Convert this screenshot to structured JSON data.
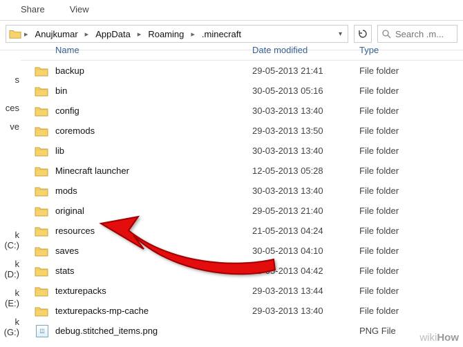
{
  "ribbon": {
    "share": "Share",
    "view": "View"
  },
  "breadcrumb": [
    "Anujkumar",
    "AppData",
    "Roaming",
    ".minecraft"
  ],
  "search": {
    "placeholder": "Search .m..."
  },
  "columns": {
    "name": "Name",
    "date": "Date modified",
    "type": "Type"
  },
  "nav_fragments": {
    "s": "s",
    "ces": "ces",
    "ve": "ve",
    "drives": [
      "k (C:)",
      "k (D:)",
      "k (E:)",
      "k (G:)"
    ]
  },
  "rows": [
    {
      "icon": "folder",
      "name": "backup",
      "date": "29-05-2013 21:41",
      "type": "File folder"
    },
    {
      "icon": "folder",
      "name": "bin",
      "date": "30-05-2013 05:16",
      "type": "File folder"
    },
    {
      "icon": "folder",
      "name": "config",
      "date": "30-03-2013 13:40",
      "type": "File folder"
    },
    {
      "icon": "folder",
      "name": "coremods",
      "date": "29-03-2013 13:50",
      "type": "File folder"
    },
    {
      "icon": "folder",
      "name": "lib",
      "date": "30-03-2013 13:40",
      "type": "File folder"
    },
    {
      "icon": "folder",
      "name": "Minecraft launcher",
      "date": "12-05-2013 05:28",
      "type": "File folder"
    },
    {
      "icon": "folder",
      "name": "mods",
      "date": "30-03-2013 13:40",
      "type": "File folder"
    },
    {
      "icon": "folder",
      "name": "original",
      "date": "29-05-2013 21:40",
      "type": "File folder"
    },
    {
      "icon": "folder",
      "name": "resources",
      "date": "21-05-2013 04:24",
      "type": "File folder"
    },
    {
      "icon": "folder",
      "name": "saves",
      "date": "30-05-2013 04:10",
      "type": "File folder"
    },
    {
      "icon": "folder",
      "name": "stats",
      "date": "30-05-2013 04:42",
      "type": "File folder"
    },
    {
      "icon": "folder",
      "name": "texturepacks",
      "date": "29-03-2013 13:44",
      "type": "File folder"
    },
    {
      "icon": "folder",
      "name": "texturepacks-mp-cache",
      "date": "29-03-2013 13:40",
      "type": "File folder"
    },
    {
      "icon": "png",
      "name": "debug.stitched_items.png",
      "date": "",
      "type": "PNG File"
    }
  ],
  "watermark": {
    "wiki": "wiki",
    "how": "How"
  }
}
